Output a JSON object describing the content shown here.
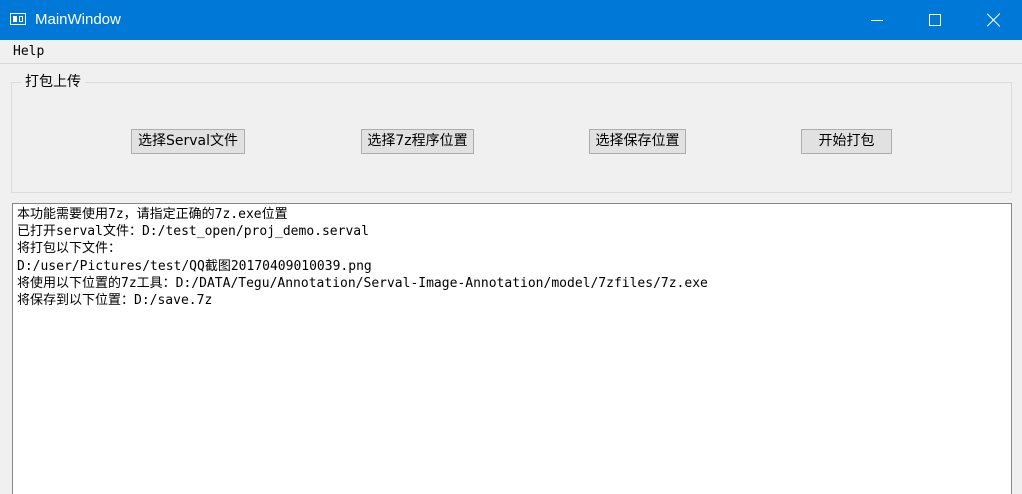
{
  "window": {
    "title": "MainWindow",
    "controls": [
      "minimize",
      "maximize",
      "close"
    ]
  },
  "menubar": {
    "items": [
      {
        "label": "Help"
      }
    ]
  },
  "group": {
    "title": "打包上传",
    "buttons": [
      {
        "label": "选择Serval文件"
      },
      {
        "label": "选择7z程序位置"
      },
      {
        "label": "选择保存位置"
      },
      {
        "label": "开始打包"
      }
    ]
  },
  "output": {
    "lines": [
      "本功能需要使用7z，请指定正确的7z.exe位置",
      "已打开serval文件：D:/test_open/proj_demo.serval",
      "将打包以下文件：",
      "D:/user/Pictures/test/QQ截图20170409010039.png",
      "将使用以下位置的7z工具：D:/DATA/Tegu/Annotation/Serval-Image-Annotation/model/7zfiles/7z.exe",
      "将保存到以下位置：D:/save.7z"
    ]
  }
}
